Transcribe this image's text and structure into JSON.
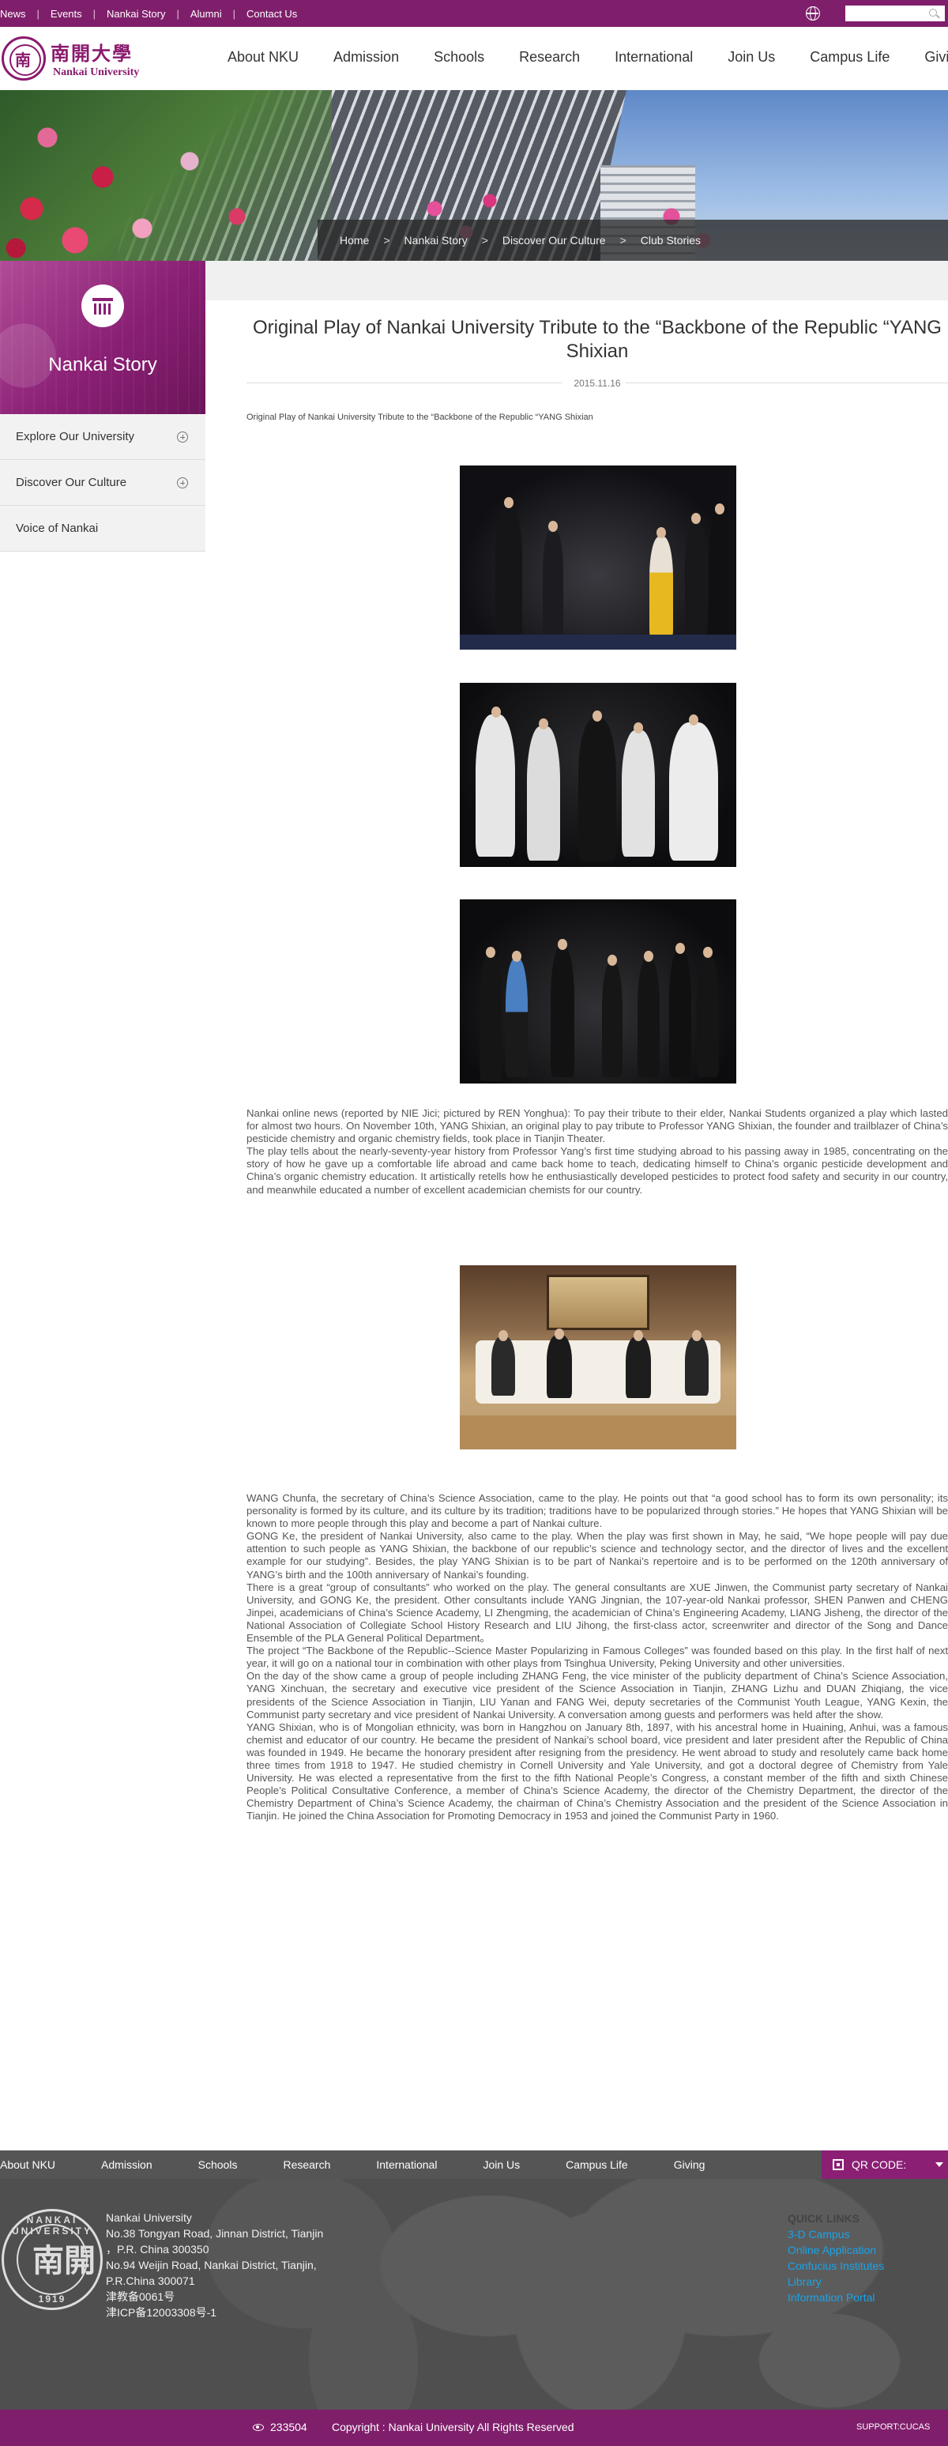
{
  "topbar": {
    "links": [
      "News",
      "Events",
      "Nankai Story",
      "Alumni",
      "Contact Us"
    ],
    "search_placeholder": ""
  },
  "header": {
    "logo_cn": "南開大學",
    "logo_en": "Nankai University",
    "nav": [
      "About NKU",
      "Admission",
      "Schools",
      "Research",
      "International",
      "Join Us",
      "Campus Life",
      "Giving"
    ]
  },
  "breadcrumb": [
    "Home",
    "Nankai Story",
    "Discover Our Culture",
    "Club Stories"
  ],
  "sidebar": {
    "title": "Nankai Story",
    "items": [
      {
        "label": "Explore Our University",
        "expandable": true
      },
      {
        "label": "Discover Our Culture",
        "expandable": true
      },
      {
        "label": "Voice of Nankai",
        "expandable": false
      }
    ]
  },
  "article": {
    "title": "Original Play of Nankai University Tribute to the “Backbone of the Republic “YANG Shixian",
    "date": "2015.11.16",
    "subtitle": "Original Play of Nankai University   Tribute to the “Backbone of the Republic “YANG Shixian",
    "para1": [
      "Nankai online news (reported by NIE Jici; pictured by REN Yonghua): To pay their tribute to their elder, Nankai Students organized a play which lasted for almost two hours. On November 10th, YANG Shixian, an original play to pay tribute to Professor YANG Shixian, the founder and trailblazer of China’s pesticide chemistry and organic chemistry fields, took place in Tianjin Theater.",
      "The play tells about the nearly-seventy-year history from Professor Yang’s first time studying abroad to his passing away in 1985, concentrating on the story of how he gave up a comfortable life abroad and came back home to teach, dedicating himself to China’s organic pesticide development and China’s organic chemistry education. It artistically retells how he enthusiastically developed pesticides to protect food safety and security in our country, and meanwhile educated a number of excellent academician chemists for our country."
    ],
    "para2": [
      "WANG Chunfa, the secretary of China’s Science Association, came to the play. He points out that “a good school has to form its own personality; its personality is formed by its culture, and its culture by its tradition; traditions have to be popularized through stories.” He hopes that YANG Shixian will be known to more people through this play and become a part of Nankai culture.",
      "GONG Ke, the president of Nankai University, also came to the play. When the play was first shown in May, he said, “We hope people will pay due attention to such people as YANG Shixian, the backbone of our republic’s science and technology sector, and the director of lives and the excellent example for our studying”. Besides, the play YANG Shixian is to be part of Nankai’s repertoire and is to be performed on the 120th anniversary of YANG’s birth and the 100th anniversary of Nankai’s founding.",
      "There is a great “group of consultants” who worked on the play. The general consultants are XUE Jinwen, the Communist party secretary of Nankai University, and GONG Ke, the president. Other consultants include YANG Jingnian, the 107-year-old Nankai professor, SHEN Panwen and CHENG Jinpei, academicians of China’s Science Academy, LI Zhengming, the academician of China’s Engineering Academy, LIANG Jisheng, the director of the National Association of Collegiate School History Research and LIU Jihong, the first-class actor, screenwriter and director of the Song and Dance Ensemble of the PLA General Political Department。",
      "The project “The Backbone of the Republic--Science Master Popularizing in Famous Colleges” was founded based on this play. In the first half of next year, it will go on a national tour in combination with other plays from Tsinghua University, Peking University and other universities.",
      "On the day of the show came a group of people including ZHANG Feng, the vice minister of the publicity department of China’s Science Association, YANG Xinchuan, the secretary and executive vice president of the Science Association in Tianjin, ZHANG Lizhu and DUAN Zhiqiang, the vice presidents of the Science Association in Tianjin, LIU Yanan and FANG Wei, deputy secretaries of the Communist Youth League, YANG Kexin, the Communist party secretary and vice president of Nankai University. A conversation among guests and performers was held after the show.",
      "YANG Shixian, who is of Mongolian ethnicity, was born in Hangzhou on January 8th, 1897, with his ancestral home in Huaining, Anhui, was a famous chemist and educator of our country. He became the president of Nankai’s school board, vice president and later president after the Republic of China was founded in 1949. He became the honorary president after resigning from the presidency. He went abroad to study and resolutely came back home three times from 1918 to 1947. He studied chemistry in Cornell University and Yale University, and got a doctoral degree of Chemistry from Yale University. He was elected a representative from the first to the fifth National People’s Congress, a constant member of the fifth and sixth Chinese People’s Political Consultative Conference, a member of China’s Science Academy, the director of the Chemistry Department, the director of the Chemistry Department of China’s Science Academy, the chairman of China’s Chemistry Association and the president of the Science Association in Tianjin. He joined the China Association for Promoting Democracy in 1953 and joined the Communist Party in 1960."
    ]
  },
  "footer": {
    "nav": [
      "About NKU",
      "Admission",
      "Schools",
      "Research",
      "International",
      "Join Us",
      "Campus Life",
      "Giving"
    ],
    "qr_label": "QR CODE",
    "seal_top": "NANKAI UNIVERSITY",
    "seal_char": "南開",
    "seal_year": "1919",
    "address": [
      "Nankai University",
      "No.38 Tongyan Road, Jinnan District, Tianjin",
      "，P.R. China 300350",
      "No.94 Weijin Road,  Nankai District, Tianjin,",
      "P.R.China  300071",
      "津教备0061号",
      "津ICP备12003308号-1"
    ],
    "quick_links_heading": "QUICK LINKS",
    "quick_links": [
      "3-D Campus",
      "Online Application",
      "Confucius Institutes",
      "Library",
      "Information Portal"
    ],
    "visit_count": "233504",
    "copyright": "Copyright : Nankai University All Rights Reserved",
    "support": "SUPPORT:CUCAS"
  }
}
